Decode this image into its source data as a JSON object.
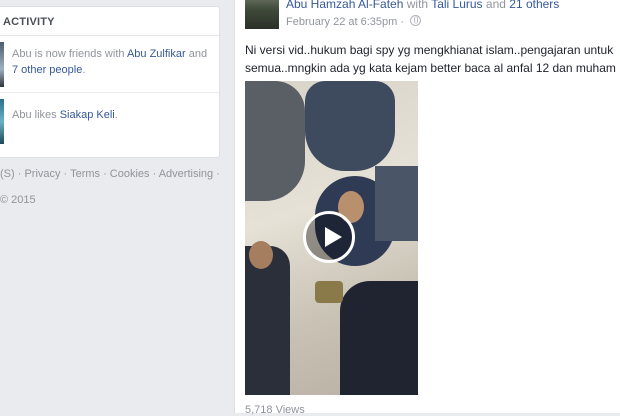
{
  "activity": {
    "header": "ACTIVITY",
    "items": [
      {
        "prefix": "Abu is now friends with ",
        "link": "Abu Zulfikar",
        "mid": " and ",
        "link2": "7 other people",
        "suffix": "."
      },
      {
        "prefix": "Abu likes ",
        "link": "Siakap Keli",
        "mid": "",
        "link2": "",
        "suffix": "."
      }
    ]
  },
  "footer": {
    "links": "(S) · Privacy · Terms · Cookies · Advertising ·",
    "copyright": "© 2015"
  },
  "post": {
    "author": "Abu Hamzah Al-Fateh",
    "with_text": " with ",
    "tagged": "Tali Lurus",
    "and_text": " and ",
    "others": "21 others",
    "timestamp": "February 22 at 6:35pm · ",
    "text": "Ni versi vid..hukum bagi spy yg mengkhianat islam..pengajaran untuk semua..mngkin ada yg kata kejam better baca al anfal 12 dan muham",
    "views": "5,718 Views"
  },
  "icons": {
    "privacy": "globe-icon",
    "video_play": "play-icon"
  },
  "colors": {
    "link": "#365899",
    "muted": "#90949c",
    "page_bg": "#e9ebee"
  }
}
